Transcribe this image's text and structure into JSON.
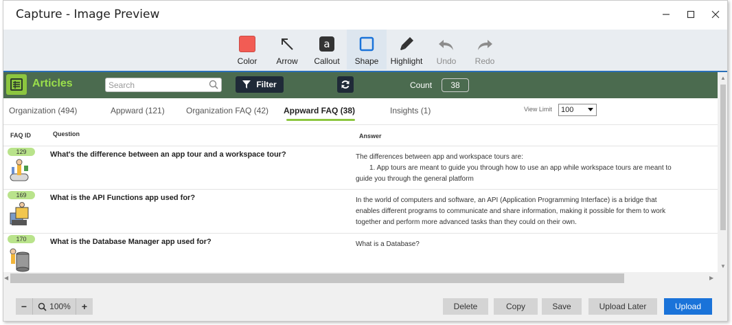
{
  "window": {
    "title": "Capture - Image Preview",
    "minimize_icon": "minimize-icon",
    "maximize_icon": "maximize-icon",
    "close_icon": "close-icon"
  },
  "toolbar": {
    "tools": [
      {
        "label": "Color",
        "icon": "color-swatch-icon",
        "color": "#f25c54",
        "enabled": true
      },
      {
        "label": "Arrow",
        "icon": "arrow-icon",
        "enabled": true
      },
      {
        "label": "Callout",
        "icon": "callout-icon",
        "enabled": true
      },
      {
        "label": "Shape",
        "icon": "shape-square-icon",
        "enabled": true,
        "active": true
      },
      {
        "label": "Highlight",
        "icon": "highlight-pen-icon",
        "enabled": true
      },
      {
        "label": "Undo",
        "icon": "undo-icon",
        "enabled": false
      },
      {
        "label": "Redo",
        "icon": "redo-icon",
        "enabled": false
      }
    ]
  },
  "app": {
    "title": "Articles",
    "search_placeholder": "Search",
    "filter_label": "Filter",
    "count_label": "Count",
    "count_value": "38",
    "tabs": [
      {
        "label": "Organization (494)"
      },
      {
        "label": "Appward (121)"
      },
      {
        "label": "Organization FAQ (42)"
      },
      {
        "label": "Appward FAQ (38)",
        "active": true
      },
      {
        "label": "Insights (1)"
      }
    ],
    "view_limit_label": "View Limit",
    "view_limit_value": "100",
    "columns": {
      "id": "FAQ ID",
      "question": "Question",
      "answer": "Answer"
    },
    "rows": [
      {
        "id": "129",
        "question": "What's the difference between an app tour and a workspace tour?",
        "answer_lines": [
          "The differences between app and workspace tours are:",
          "1. App tours are meant to guide you through how to use an app while workspace tours are meant to",
          "guide you through the general platform"
        ]
      },
      {
        "id": "169",
        "question": "What is the API Functions app used for?",
        "answer_lines": [
          "In the world of computers and software, an API (Application Programming Interface) is a bridge that",
          "enables different programs to communicate and share information, making it possible for them to work",
          "together and perform more advanced tasks than they could on their own."
        ]
      },
      {
        "id": "170",
        "question": "What is the Database Manager app used for?",
        "answer_lines": [
          "What is a Database?"
        ]
      }
    ]
  },
  "bottom": {
    "zoom_out": "−",
    "zoom_value": "100%",
    "zoom_in": "+",
    "delete": "Delete",
    "copy": "Copy",
    "save": "Save",
    "upload_later": "Upload Later",
    "upload": "Upload"
  },
  "colors": {
    "appbar": "#4b6b4f",
    "accent_green": "#8cc63f",
    "primary_blue": "#1a73d9",
    "swatch_red": "#f25c54"
  }
}
